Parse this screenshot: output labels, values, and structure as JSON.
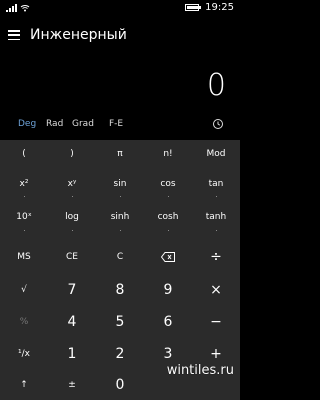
{
  "status": {
    "time": "19:25"
  },
  "app": {
    "title": "Инженерный"
  },
  "display": {
    "value": "0"
  },
  "modes": {
    "deg": "Deg",
    "rad": "Rad",
    "grad": "Grad",
    "fe": "F-E"
  },
  "keys": {
    "r1": [
      "(",
      ")",
      "π",
      "n!",
      "Mod"
    ],
    "r2": [
      "x²",
      "xʸ",
      "sin",
      "cos",
      "tan"
    ],
    "r3": [
      "10ˣ",
      "log",
      "sinh",
      "cosh",
      "tanh"
    ],
    "r4": [
      "MS",
      "CE",
      "C",
      "",
      "÷"
    ],
    "r5": [
      "√",
      "7",
      "8",
      "9",
      "×"
    ],
    "r6": [
      "%",
      "4",
      "5",
      "6",
      "−"
    ],
    "r7": [
      "¹/x",
      "1",
      "2",
      "3",
      "+"
    ],
    "r8": [
      "↑",
      "±",
      "0",
      "",
      ""
    ]
  },
  "watermark": "wintiles.ru"
}
